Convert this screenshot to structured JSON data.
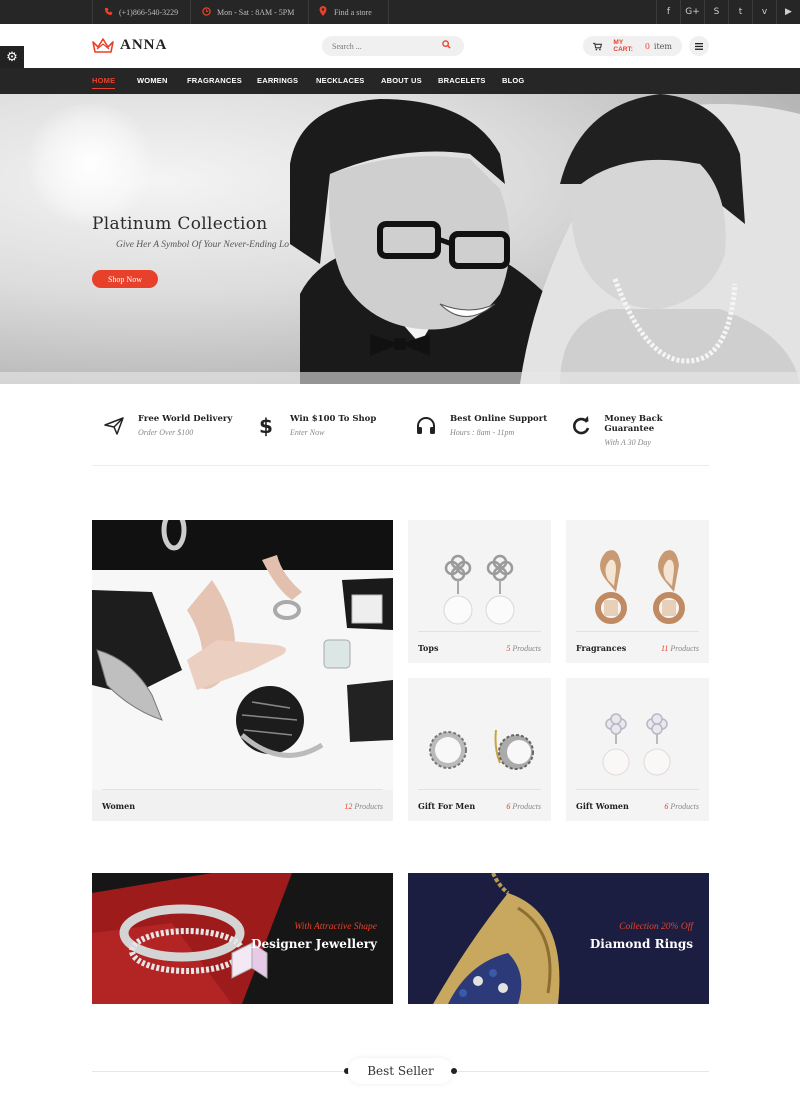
{
  "topbar": {
    "phone": "(+1)866-540-3229",
    "hours": "Mon - Sat : 8AM - 5PM",
    "store": "Find a store",
    "social": [
      "facebook-icon",
      "google-plus-icon",
      "skype-icon",
      "twitter-icon",
      "vimeo-icon",
      "youtube-icon"
    ],
    "social_glyphs": [
      "f",
      "G+",
      "S",
      "t",
      "v",
      "▶"
    ]
  },
  "header": {
    "logo": "ANNA",
    "search_placeholder": "Search ...",
    "cart_label": "MY CART:",
    "cart_count": "0",
    "cart_item": "item"
  },
  "nav": {
    "items": [
      "HOME",
      "WOMEN",
      "FRAGRANCES",
      "EARRINGS",
      "NECKLACES",
      "ABOUT US",
      "BRACELETS",
      "BLOG"
    ],
    "active": "HOME"
  },
  "hero": {
    "title": "Platinum Collection",
    "subtitle": "Give Her A Symbol Of Your Never-Ending Lo",
    "button": "Shop Now"
  },
  "features": [
    {
      "title": "Free World Delivery",
      "sub": "Order Over $100",
      "icon": "paper-plane-icon"
    },
    {
      "title": "Win $100 To Shop",
      "sub": "Enter Now",
      "icon": "dollar-icon"
    },
    {
      "title": "Best Online Support",
      "sub": "Hours : 8am - 11pm",
      "icon": "headphones-icon"
    },
    {
      "title": "Money Back Guarantee",
      "sub": "With A 30 Day",
      "icon": "refresh-icon"
    }
  ],
  "categories": [
    {
      "name": "Women",
      "count": "12",
      "unit": "Products"
    },
    {
      "name": "Tops",
      "count": "5",
      "unit": "Products"
    },
    {
      "name": "Fragrances",
      "count": "11",
      "unit": "Products"
    },
    {
      "name": "Gift For Men",
      "count": "6",
      "unit": "Products"
    },
    {
      "name": "Gift Women",
      "count": "6",
      "unit": "Products"
    }
  ],
  "banners": [
    {
      "sub": "With Attractive Shape",
      "title": "Designer Jewellery"
    },
    {
      "sub": "Collection 20% Off",
      "title": "Diamond Rings"
    }
  ],
  "best_seller": "Best Seller",
  "colors": {
    "accent": "#e8412b",
    "dark": "#262626"
  }
}
